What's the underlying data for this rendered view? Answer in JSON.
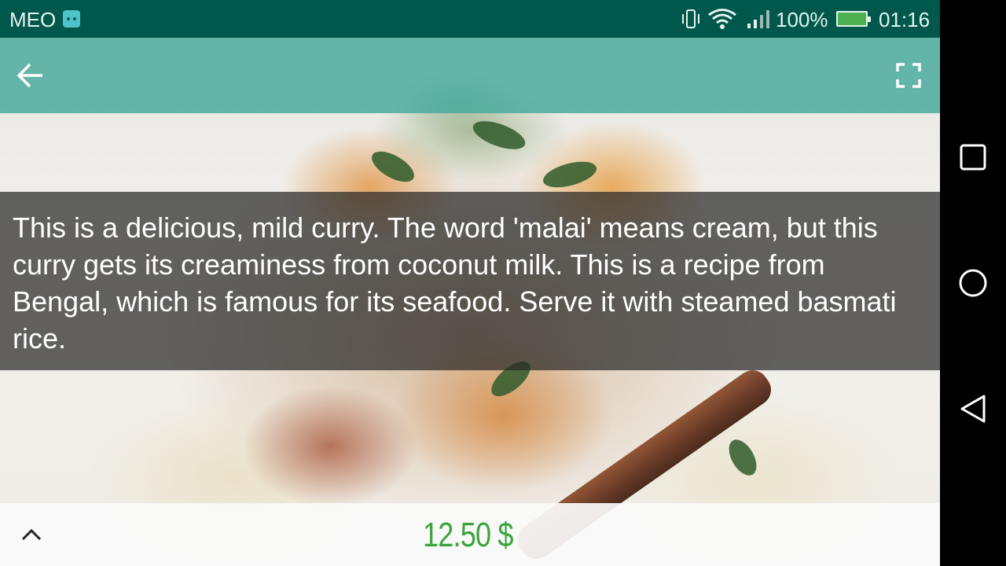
{
  "status_bar": {
    "carrier": "MEO",
    "battery": "100%",
    "time": "01:16",
    "icons": [
      "android-notification-icon",
      "vibrate-icon",
      "wifi-icon",
      "signal-icon",
      "battery-charging-icon"
    ]
  },
  "toolbar": {
    "back_icon": "arrow-back-icon",
    "fullscreen_icon": "fullscreen-icon"
  },
  "description": {
    "text": "This is a delicious, mild curry. The word 'malai' means cream, but this curry gets its creaminess from coconut milk. This is a recipe from Bengal, which is famous for its seafood. Serve it with steamed basmati rice."
  },
  "bottom_bar": {
    "price": "12.50 $",
    "expand_icon": "chevron-up-icon"
  },
  "navigation": {
    "icons": [
      "recents-square-icon",
      "home-circle-icon",
      "back-triangle-icon"
    ]
  },
  "colors": {
    "status_bar": "#00574b",
    "toolbar": "#46aa9b",
    "price": "#3aa53a"
  }
}
